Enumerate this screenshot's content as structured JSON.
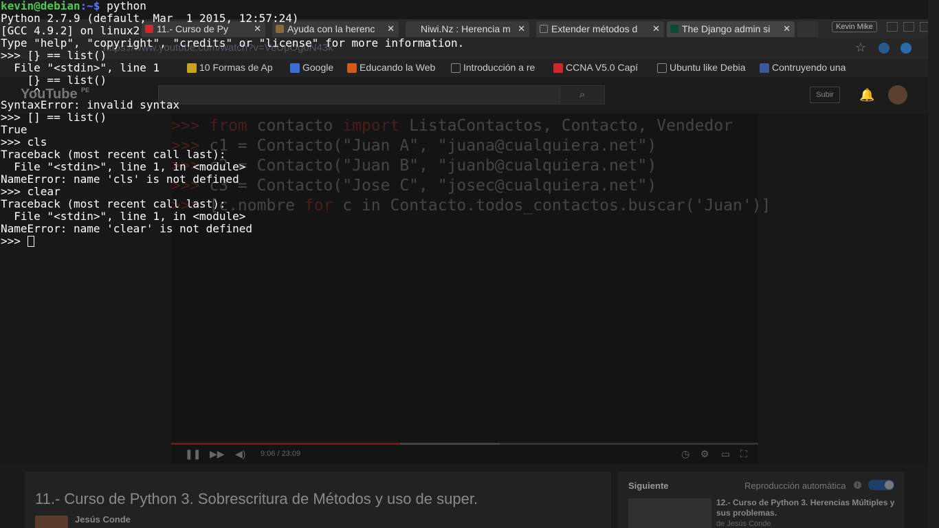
{
  "browser": {
    "tabs": [
      {
        "label": "11.- Curso de Py",
        "color": "#cc2a2a",
        "icon": "youtube-icon"
      },
      {
        "label": "Ayuda con la herenc",
        "color": "#8a6a3a",
        "icon": "forum-icon"
      },
      {
        "label": "Niwi.Nz : Herencia m",
        "color": "#444444",
        "icon": "page-icon"
      },
      {
        "label": "Extender métodos d",
        "color": "#666666",
        "icon": "document-icon"
      },
      {
        "label": "The Django admin si",
        "color": "#0c4b33",
        "icon": "django-icon"
      }
    ],
    "user_chip": "Kevin Mike",
    "url": "https://www.youtube.com/watch?v=VeUpOg0N43k",
    "bookmarks": [
      {
        "label": "10 Formas de Ap",
        "color": "#c9a227"
      },
      {
        "label": "Google",
        "color": "#3b6fd4"
      },
      {
        "label": "Educando la Web",
        "color": "#d85a1a"
      },
      {
        "label": "Introducción a re",
        "color": "#777777"
      },
      {
        "label": "CCNA V5.0 Capí",
        "color": "#cc2a2a"
      },
      {
        "label": "Ubuntu like Debia",
        "color": "#777777"
      },
      {
        "label": "Contruyendo una",
        "color": "#3b5998"
      }
    ],
    "youtube": {
      "logo": "YouTube",
      "logo_suffix": "PE",
      "upload_label": "Subir",
      "code_lines": [
        {
          "prompt": ">>> ",
          "kw1": "from",
          "mid": " contacto ",
          "kw2": "import",
          "rest": " ListaContactos, Contacto, Vendedor"
        },
        {
          "prompt": ">>> ",
          "kw1": "",
          "mid": "c1 = Contacto(\"Juan A\", \"juana@cualquiera.net\")",
          "kw2": "",
          "rest": ""
        },
        {
          "prompt": ">>> ",
          "kw1": "",
          "mid": "c2 = Contacto(\"Juan B\", \"juanb@cualquiera.net\")",
          "kw2": "",
          "rest": ""
        },
        {
          "prompt": ">>> ",
          "kw1": "",
          "mid": "c3 = Contacto(\"Jose C\", \"josec@cualquiera.net\")",
          "kw2": "",
          "rest": ""
        },
        {
          "prompt": ">>> ",
          "kw1": "",
          "mid": "[c.nombre ",
          "kw2": "for",
          "rest": " c in Contacto.todos_contactos.buscar('Juan')]"
        }
      ],
      "time": "9:06 / 23:09",
      "progress": 0.39,
      "buffered": 0.56,
      "video_title": "11.- Curso de Python 3. Sobrescritura de Métodos y uso de super.",
      "channel": "Jesús Conde",
      "next_heading": "Siguiente",
      "autoplay_label": "Reproducción automática",
      "next_title": "12.- Curso de Python 3. Herencias Múltiples y sus problemas.",
      "next_author": "de Jesús Conde"
    }
  },
  "terminal": {
    "prompt_user": "kevin@debian",
    "prompt_path": ":~$ ",
    "first_command": "python",
    "lines": [
      "Python 2.7.9 (default, Mar  1 2015, 12:57:24)",
      "[GCC 4.9.2] on linux2",
      "Type \"help\", \"copyright\", \"credits\" or \"license\" for more information.",
      ">>> [} == list()",
      "  File \"<stdin>\", line 1",
      "    [} == list()",
      "     ^",
      "SyntaxError: invalid syntax",
      ">>> [] == list()",
      "True",
      ">>> cls",
      "Traceback (most recent call last):",
      "  File \"<stdin>\", line 1, in <module>",
      "NameError: name 'cls' is not defined",
      ">>> clear",
      "Traceback (most recent call last):",
      "  File \"<stdin>\", line 1, in <module>",
      "NameError: name 'clear' is not defined"
    ],
    "final_prompt": ">>> "
  }
}
